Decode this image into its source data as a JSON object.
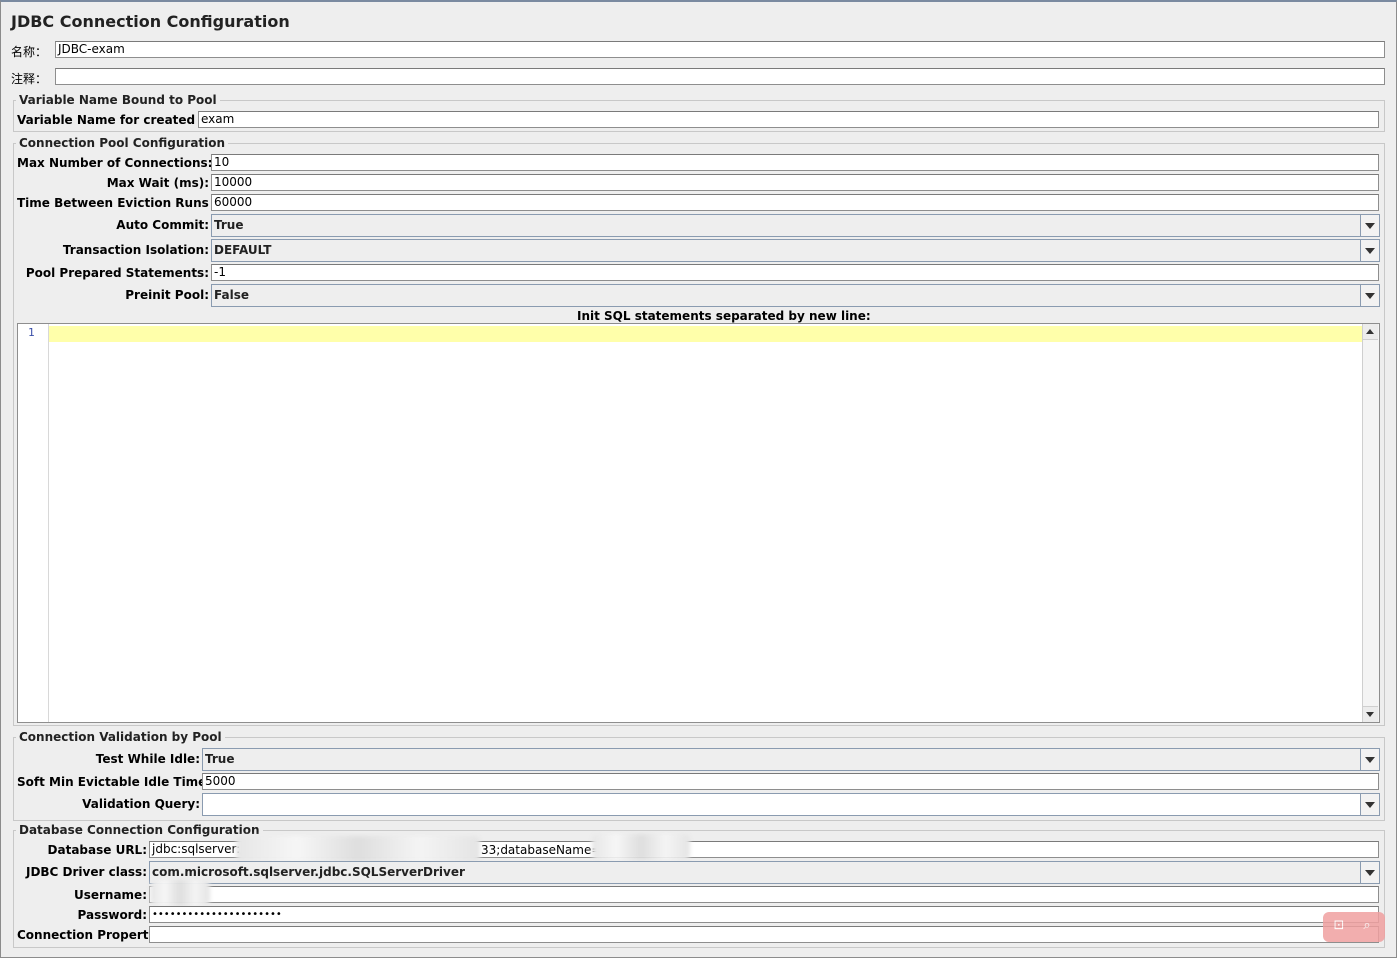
{
  "window": {
    "title": "JDBC Connection Configuration"
  },
  "general": {
    "name_label": "名称：",
    "name_value": "JDBC-exam",
    "comment_label": "注释：",
    "comment_value": ""
  },
  "variable_group": {
    "title": "Variable Name Bound to Pool",
    "pool_var_label": "Variable Name for created pool:",
    "pool_var_value": "exam"
  },
  "pool_group": {
    "title": "Connection Pool Configuration",
    "max_connections_label": "Max Number of Connections:",
    "max_connections_value": "10",
    "max_wait_label": "Max Wait (ms):",
    "max_wait_value": "10000",
    "eviction_label": "Time Between Eviction Runs (ms):",
    "eviction_value": "60000",
    "auto_commit_label": "Auto Commit:",
    "auto_commit_value": "True",
    "isolation_label": "Transaction Isolation:",
    "isolation_value": "DEFAULT",
    "prepared_label": "Pool Prepared Statements:",
    "prepared_value": "-1",
    "preinit_label": "Preinit Pool:",
    "preinit_value": "False",
    "init_sql_label": "Init SQL statements separated by new line:",
    "init_sql_line_number": "1"
  },
  "validation_group": {
    "title": "Connection Validation by Pool",
    "test_idle_label": "Test While Idle:",
    "test_idle_value": "True",
    "soft_min_label": "Soft Min Evictable Idle Time(ms):",
    "soft_min_value": "5000",
    "query_label": "Validation Query:",
    "query_value": ""
  },
  "database_group": {
    "title": "Database Connection Configuration",
    "url_label": "Database URL:",
    "url_prefix": "jdbc:sqlserver:/",
    "url_middle": "33;databaseName=",
    "driver_label": "JDBC Driver class:",
    "driver_value": "com.microsoft.sqlserver.jdbc.SQLServerDriver",
    "username_label": "Username:",
    "password_label": "Password:",
    "password_value": "••••••••••••••••••••••",
    "properties_label": "Connection Properties:",
    "properties_value": ""
  },
  "overlay": {
    "icons": [
      "translate-icon",
      "search-icon"
    ]
  }
}
